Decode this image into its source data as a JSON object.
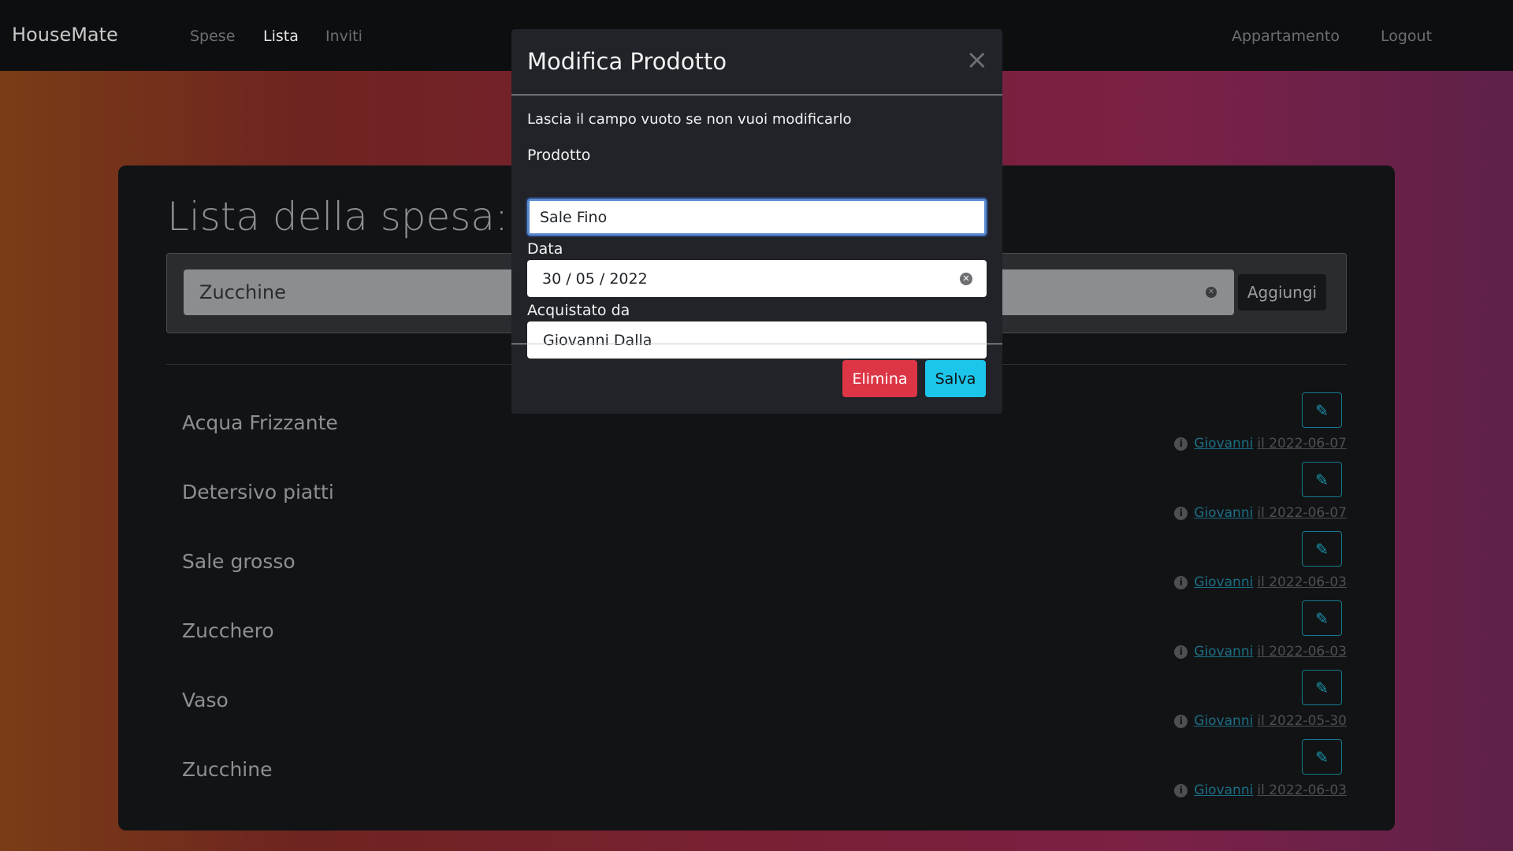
{
  "navbar": {
    "brand": "HouseMate",
    "links": [
      "Spese",
      "Lista",
      "Inviti"
    ],
    "active_link": "Lista",
    "right_links": [
      "Appartamento",
      "Logout"
    ]
  },
  "list": {
    "title": "Lista della spesa:",
    "add_input_value": "Zucchine",
    "add_button": "Aggiungi",
    "items": [
      {
        "name": "Acqua Frizzante",
        "user": "Giovanni",
        "date": "il 2022-06-07"
      },
      {
        "name": "Detersivo piatti",
        "user": "Giovanni",
        "date": "il 2022-06-07"
      },
      {
        "name": "Sale grosso",
        "user": "Giovanni",
        "date": "il 2022-06-03"
      },
      {
        "name": "Zucchero",
        "user": "Giovanni",
        "date": "il 2022-06-03"
      },
      {
        "name": "Vaso",
        "user": "Giovanni",
        "date": "il 2022-05-30"
      },
      {
        "name": "Zucchine",
        "user": "Giovanni",
        "date": "il 2022-06-03"
      }
    ]
  },
  "modal": {
    "title": "Modifica Prodotto",
    "hint": "Lascia il campo vuoto se non vuoi modificarlo",
    "product_label": "Prodotto",
    "product_value": "Sale Fino",
    "date_label": "Data",
    "date_value": "30 / 05 / 2022",
    "buyer_label": "Acquistato da",
    "buyer_value": "Giovanni Dalla",
    "delete_button": "Elimina",
    "save_button": "Salva"
  },
  "icons": {
    "close": "close-icon",
    "edit": "pencil-icon",
    "info": "info-icon",
    "clear": "clear-icon"
  },
  "colors": {
    "accent_info": "#1cc6ea",
    "danger": "#dc3545",
    "navbar_bg": "#0d0e10",
    "card_bg": "#121315"
  }
}
